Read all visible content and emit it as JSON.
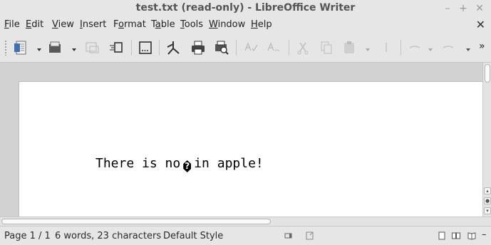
{
  "window": {
    "title": "test.txt (read-only) - LibreOffice Writer",
    "controls": [
      "–",
      "+",
      "✕"
    ]
  },
  "menubar": {
    "items": [
      {
        "label_ul": "F",
        "label_rest": "ile"
      },
      {
        "label_ul": "E",
        "label_rest": "dit"
      },
      {
        "label_ul": "V",
        "label_rest": "iew"
      },
      {
        "label_ul": "I",
        "label_rest": "nsert"
      },
      {
        "label_pre": "F",
        "label_ul": "o",
        "label_rest": "rmat"
      },
      {
        "label_pre": "T",
        "label_ul": "a",
        "label_rest": "ble"
      },
      {
        "label_ul": "T",
        "label_rest": "ools"
      },
      {
        "label_ul": "W",
        "label_rest": "indow"
      },
      {
        "label_ul": "H",
        "label_rest": "elp"
      }
    ],
    "close_doc": "✕"
  },
  "toolbar": {
    "overflow": "»",
    "icons": [
      "new-document-icon",
      "open-folder-icon",
      "save-icon",
      "export-icon",
      "print-icon",
      "print-preview-icon",
      "spelling-icon"
    ]
  },
  "document": {
    "text_before": "There is no",
    "replacement_char": "?",
    "text_after": "in apple!"
  },
  "statusbar": {
    "page": "Page 1 / 1",
    "words": "6 words, 23 characters",
    "style": "Default Style"
  },
  "colors": {
    "chrome": "#e6e6e6",
    "canvas": "#d2d2d2",
    "page": "#ffffff",
    "icon_blue": "#3f6fb5"
  }
}
